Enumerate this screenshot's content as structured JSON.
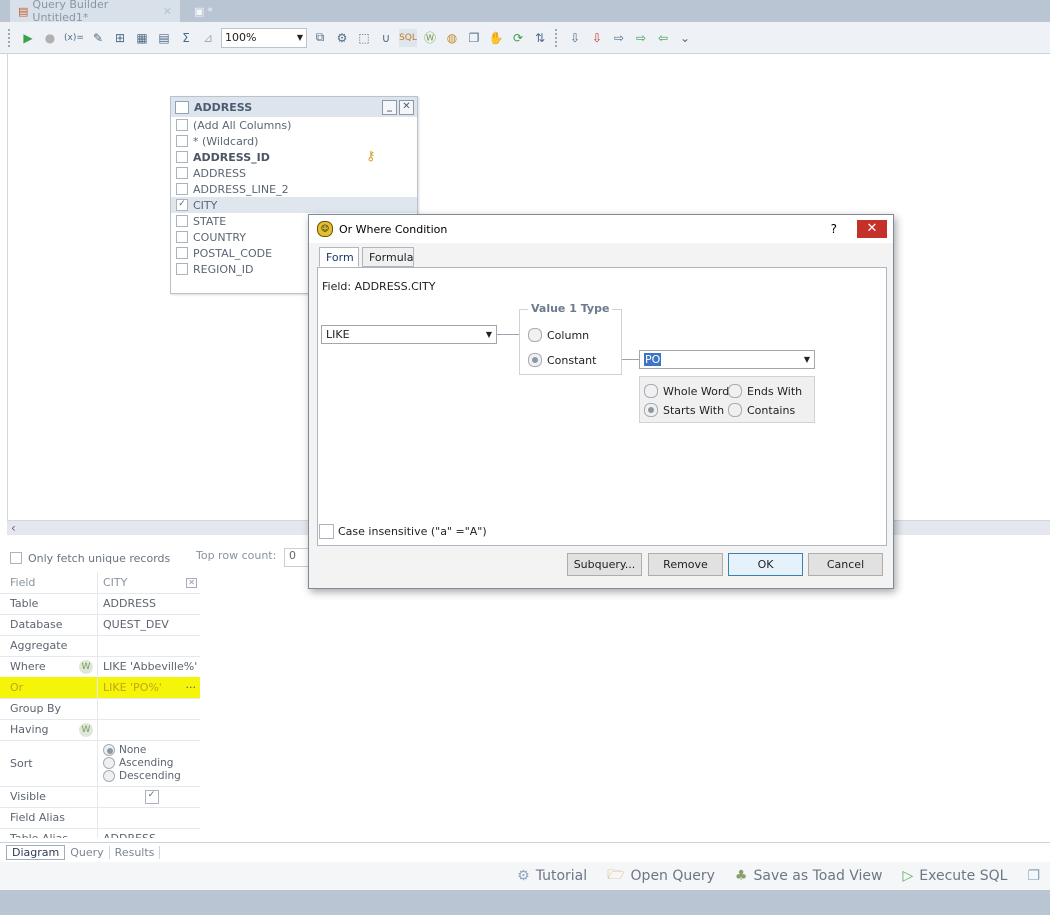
{
  "tabs": [
    {
      "label": "Query Builder Untitled1*",
      "closable": true
    },
    {
      "label": "*"
    }
  ],
  "toolbar": {
    "zoom_value": "100%",
    "icons": [
      "run-icon",
      "stop-icon",
      "variables-icon",
      "edit-icon",
      "add-table-icon",
      "grid-icon",
      "columns-icon",
      "sum-icon",
      "filter-icon",
      "zoom-dropdown",
      "layout-icon",
      "tools-icon",
      "select-icon",
      "union-icon",
      "sql-icon",
      "where-icon",
      "globe-icon",
      "copy-icon",
      "hand-icon",
      "refresh-icon",
      "sync-icon",
      "export-icon",
      "export2-icon",
      "export3-icon",
      "export4-icon",
      "export5-icon"
    ]
  },
  "table_widget": {
    "title": "ADDRESS",
    "columns": [
      {
        "label": "(Add All Columns)",
        "checked": false,
        "bold": false
      },
      {
        "label": "* (Wildcard)",
        "checked": false,
        "bold": false
      },
      {
        "label": "ADDRESS_ID",
        "checked": false,
        "bold": true
      },
      {
        "label": "ADDRESS",
        "checked": false,
        "bold": false
      },
      {
        "label": "ADDRESS_LINE_2",
        "checked": false,
        "bold": false
      },
      {
        "label": "CITY",
        "checked": true,
        "bold": false
      },
      {
        "label": "STATE",
        "checked": false,
        "bold": false
      },
      {
        "label": "COUNTRY",
        "checked": false,
        "bold": false
      },
      {
        "label": "POSTAL_CODE",
        "checked": false,
        "bold": false
      },
      {
        "label": "REGION_ID",
        "checked": false,
        "bold": false
      }
    ]
  },
  "lower_pane": {
    "unique_label": "Only fetch unique records",
    "top_row_label": "Top row count:",
    "top_row_value": "0"
  },
  "grid": {
    "header": {
      "field": "Field",
      "value": "CITY"
    },
    "rows": [
      {
        "label": "Table",
        "value": "ADDRESS"
      },
      {
        "label": "Database",
        "value": "QUEST_DEV"
      },
      {
        "label": "Aggregate",
        "value": ""
      },
      {
        "label": "Where",
        "value": "LIKE 'Abbeville%'"
      },
      {
        "label": "Or",
        "value": "LIKE 'PO%'"
      },
      {
        "label": "Group By",
        "value": ""
      },
      {
        "label": "Having",
        "value": ""
      },
      {
        "label": "Sort",
        "value": ""
      },
      {
        "label": "Visible",
        "value": ""
      },
      {
        "label": "Field Alias",
        "value": ""
      },
      {
        "label": "Table Alias",
        "value": "ADDRESS"
      }
    ],
    "sort_options": [
      "None",
      "Ascending",
      "Descending"
    ],
    "sort_selected": "None",
    "ellipsis": "···"
  },
  "bottom_tabs": [
    "Diagram",
    "Query",
    "Results"
  ],
  "actions": {
    "tutorial": "Tutorial",
    "open_query": "Open Query",
    "save_view": "Save as Toad View",
    "execute": "Execute SQL"
  },
  "dialog": {
    "title": "Or Where Condition",
    "help": "?",
    "close": "✕",
    "tabs": [
      "Form",
      "Formula"
    ],
    "field_label": "Field: ADDRESS.CITY",
    "operator": "LIKE",
    "value_type_label": "Value 1 Type",
    "value_type_options": [
      "Column",
      "Constant"
    ],
    "value_type_selected": "Constant",
    "value": "PO",
    "match_options": [
      "Whole Word",
      "Ends With",
      "Starts With",
      "Contains"
    ],
    "match_selected": "Starts With",
    "case_label": "Case insensitive (\"a\" =\"A\")",
    "buttons": {
      "subquery": "Subquery...",
      "remove": "Remove",
      "ok": "OK",
      "cancel": "Cancel"
    }
  }
}
